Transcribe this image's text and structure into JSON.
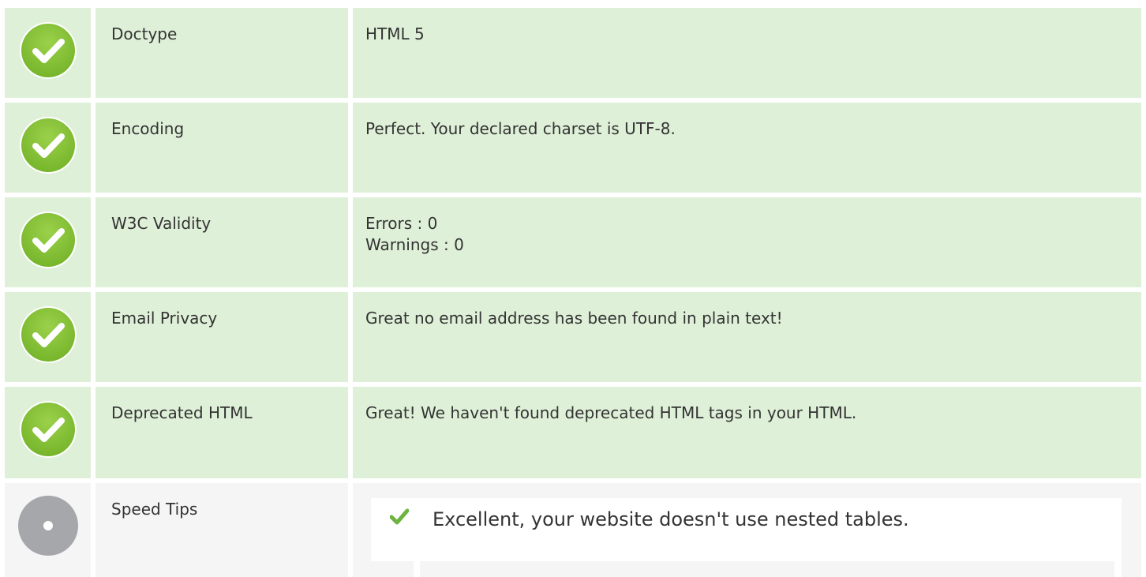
{
  "rows": [
    {
      "label": "Doctype",
      "value": "HTML 5"
    },
    {
      "label": "Encoding",
      "value": "Perfect. Your declared charset is UTF-8."
    },
    {
      "label": "W3C Validity",
      "value_lines": [
        "Errors : 0",
        "Warnings : 0"
      ]
    },
    {
      "label": "Email Privacy",
      "value": "Great no email address has been found in plain text!"
    },
    {
      "label": "Deprecated HTML",
      "value": "Great! We haven't found deprecated HTML tags in your HTML."
    }
  ],
  "speed_tips": {
    "label": "Speed Tips",
    "items": [
      {
        "text": "Excellent, your website doesn't use nested tables."
      }
    ]
  },
  "colors": {
    "pass_bg": "#dff0d8",
    "neutral_bg": "#f5f5f5",
    "check_green": "#8dc63f",
    "neutral_gray": "#a6a7ab"
  },
  "icons": {
    "pass": "check-circle-icon",
    "neutral": "neutral-circle-icon",
    "tip": "checkmark-icon"
  }
}
